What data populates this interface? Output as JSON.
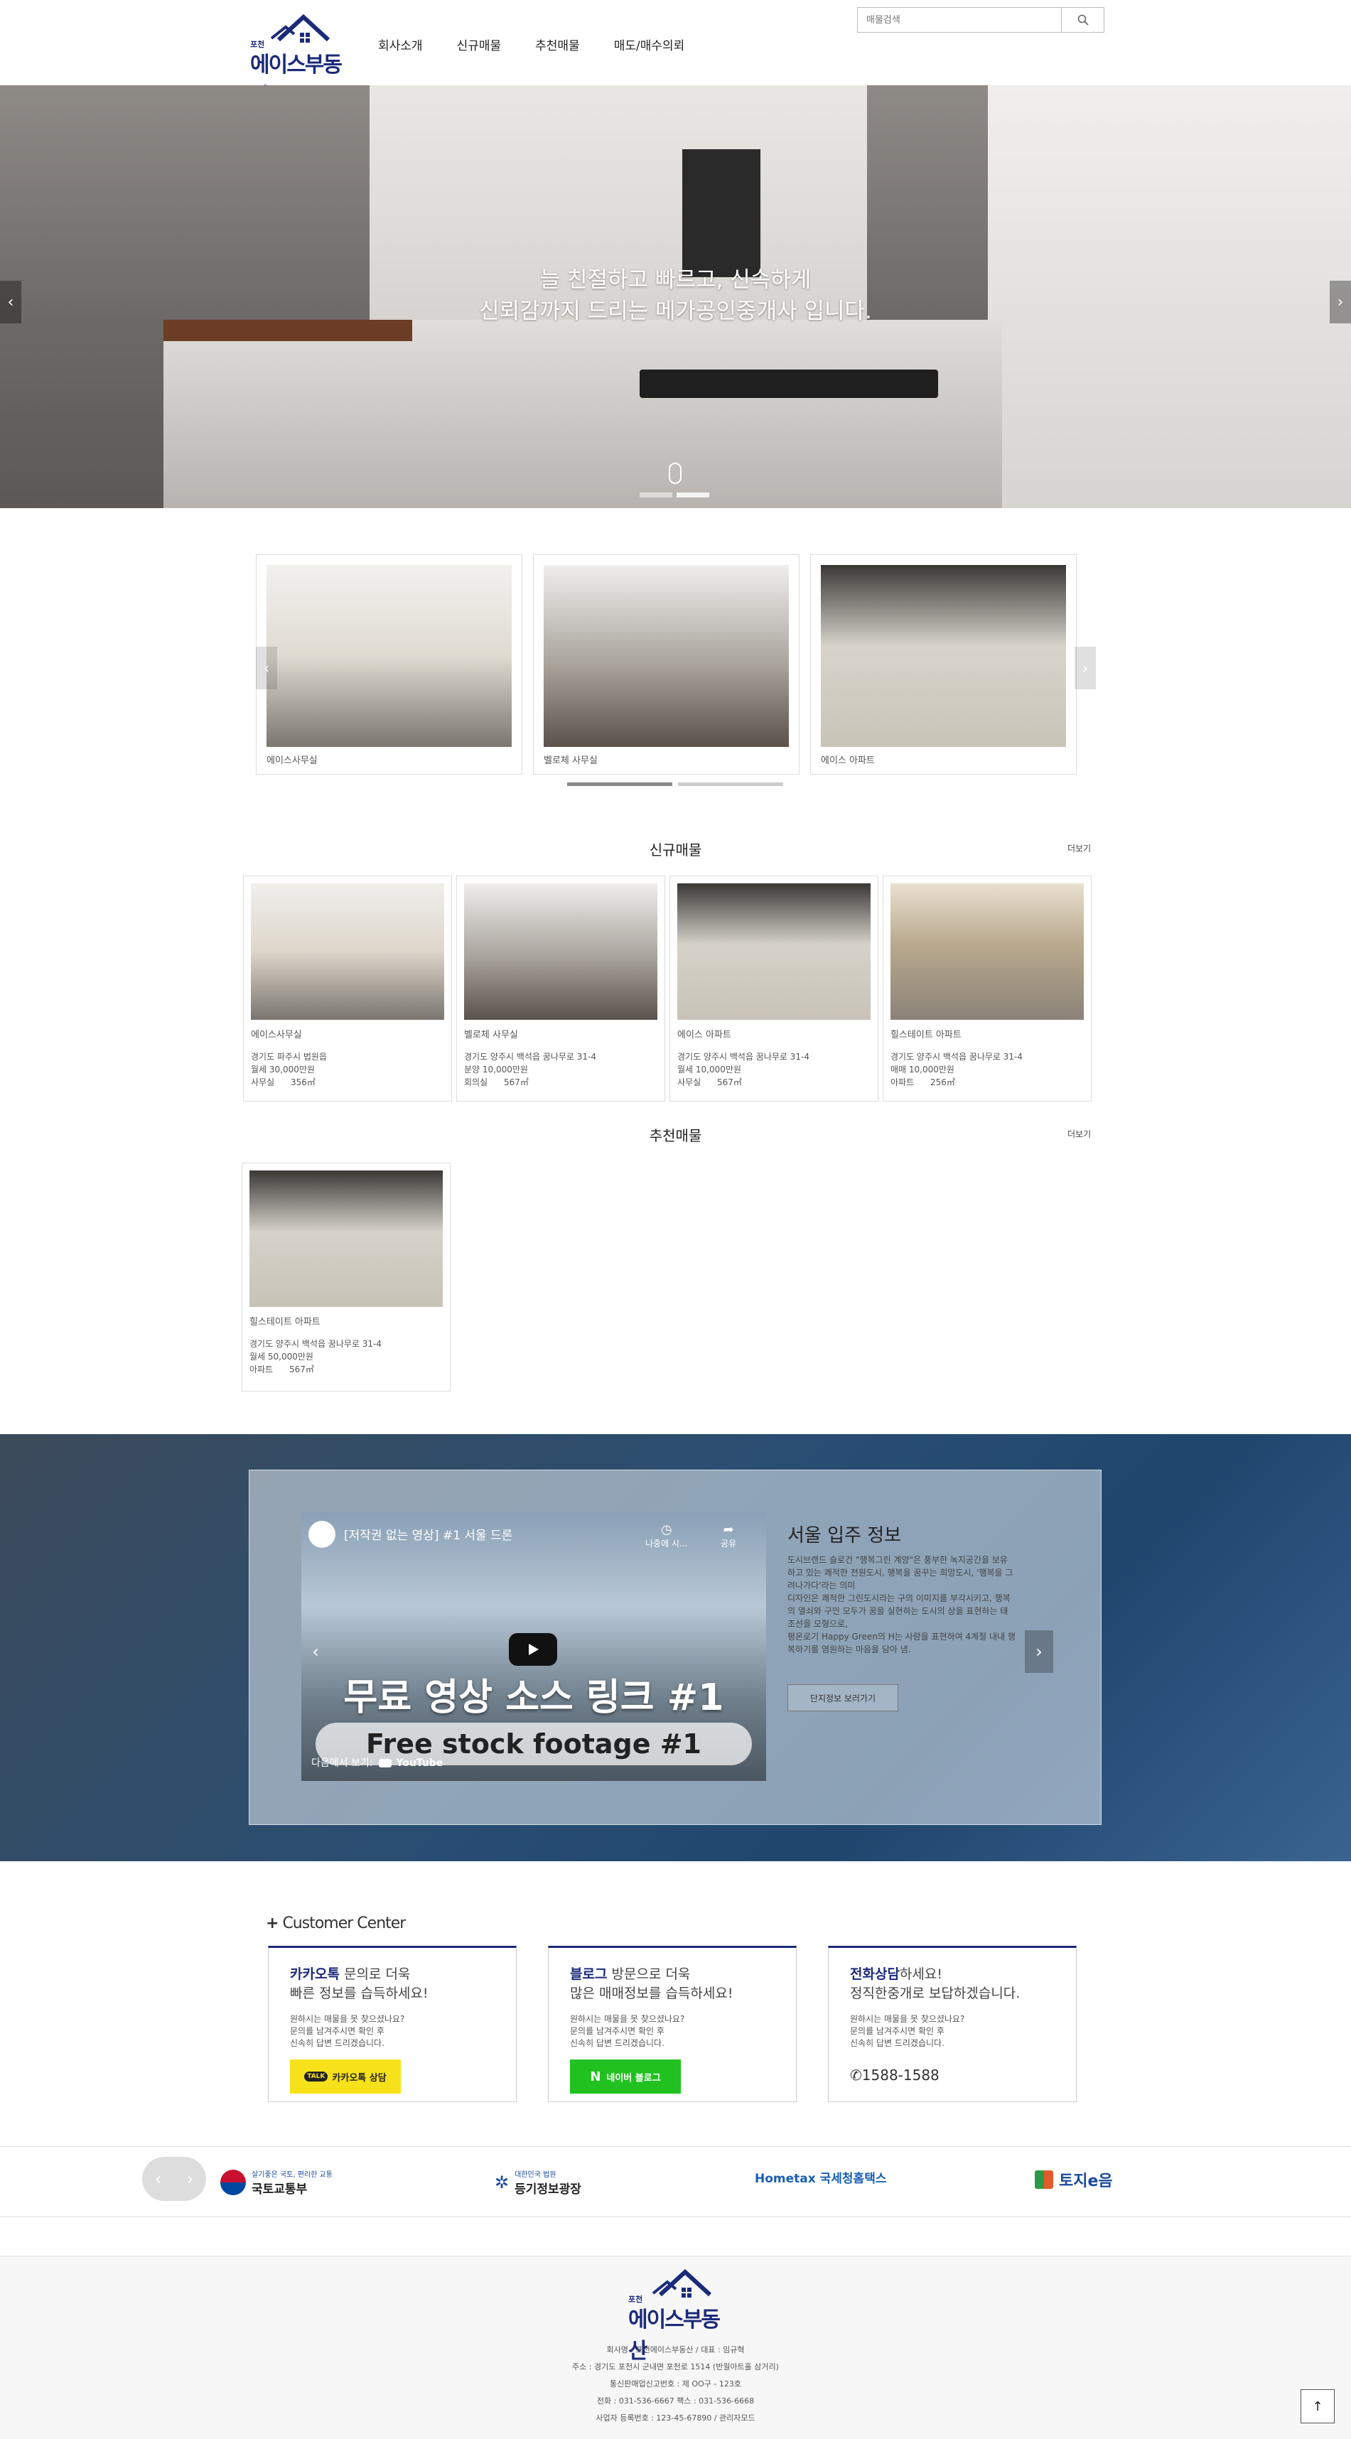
{
  "brand": {
    "small": "포천",
    "name": "에이스부동산"
  },
  "nav": [
    "회사소개",
    "신규매물",
    "추천매물",
    "매도/매수의뢰"
  ],
  "search": {
    "placeholder": "매물검색"
  },
  "hero": {
    "line1": "늘 친절하고 빠르고, 신속하게",
    "line2": "신뢰감까지 드리는 메가공인중개사 입니다."
  },
  "carousel": [
    "에이스사무실",
    "벨로체 사무실",
    "에이스 아파트"
  ],
  "new_listings": {
    "title": "신규매물",
    "more": "더보기",
    "items": [
      {
        "name": "에이스사무실",
        "addr": "경기도 파주시 법원읍",
        "price": "월세 30,000만원",
        "type": "사무실",
        "area": "356㎡"
      },
      {
        "name": "벨로체 사무실",
        "addr": "경기도 양주시 백석읍 꿈나무로 31-4",
        "price": "분양 10,000만원",
        "type": "회의실",
        "area": "567㎡"
      },
      {
        "name": "에이스 아파트",
        "addr": "경기도 양주시 백석읍 꿈나무로 31-4",
        "price": "월세 10,000만원",
        "type": "사무실",
        "area": "567㎡"
      },
      {
        "name": "힐스테이트 아파트",
        "addr": "경기도 양주시 백석읍 꿈나무로 31-4",
        "price": "매매 10,000만원",
        "type": "아파트",
        "area": "256㎡"
      }
    ]
  },
  "recommended": {
    "title": "추천매물",
    "more": "더보기",
    "items": [
      {
        "name": "힐스테이트 아파트",
        "addr": "경기도 양주시 백석읍 꿈나무로 31-4",
        "price": "월세 50,000만원",
        "type": "아파트",
        "area": "567㎡"
      }
    ]
  },
  "video": {
    "title": "[저작권 없는 영상] #1 서울 드론",
    "watch_later": "나중에 시...",
    "share": "공유",
    "big_text": "무료 영상 소스 링크 #1",
    "pill_text": "Free stock footage #1",
    "watch_on": "다음에서 보기:",
    "youtube": "YouTube"
  },
  "info": {
    "title": "서울 입주 정보",
    "desc": [
      "도시브랜드 슬로건 \"행복그린 계양\"은 풍부한 녹지공간을 보유",
      "하고 있는 쾌적한 전원도시, 행복을 꿈꾸는 희망도시, '행복을 그",
      "려나가다'라는 의미",
      "디자인은 쾌적한 그린도시라는 구의 이미지를 부각시키고, 행복",
      "의 열쇠와 구민 모두가 꿈을 실현하는 도시의 상을 표현하는 태",
      "조선을 모형으로,",
      "평온로기 Happy Green의 H는 사람을 표현하여 4계절 내내 행",
      "복하기를 염원하는 마음을 담아 냄."
    ],
    "button": "단지정보 보러가기"
  },
  "customer_center": {
    "title": "Customer Center",
    "cards": [
      {
        "strong": "카카오톡",
        "rest1": " 문의로 더욱",
        "line2": "빠른 정보를 습득하세요!",
        "desc": [
          "원하시는 매물을 못 찾으셨나요?",
          "문의를 남겨주시면 확인 후",
          "신속히 답변 드리겠습니다."
        ],
        "button": "카카오톡 상담"
      },
      {
        "strong": "블로그",
        "rest1": " 방문으로 더욱",
        "line2": "많은 매매정보를 습득하세요!",
        "desc": [
          "원하시는 매물을 못 찾으셨나요?",
          "문의를 남겨주시면 확인 후",
          "신속히 답변 드리겠습니다."
        ],
        "button": "네이버 블로그"
      },
      {
        "strong": "전화상담",
        "rest1": "하세요!",
        "line2": "정직한중개로 보답하겠습니다.",
        "desc": [
          "원하시는 매물을 못 찾으셨나요?",
          "문의를 남겨주시면 확인 후",
          "신속히 답변 드리겠습니다."
        ],
        "phone": "1588-1588"
      }
    ]
  },
  "partners": [
    {
      "sub": "살기좋은 국토, 편리한 교통",
      "name": "국토교통부"
    },
    {
      "sub": "대한민국 법원",
      "name": "등기정보광장"
    },
    {
      "sub": "",
      "name": "Hometax 국세청홈택스"
    },
    {
      "sub": "",
      "name": "토지e음"
    }
  ],
  "footer": {
    "lines": [
      "회사명 : 포천에이스부동산 / 대표 : 임규혁",
      "주소 : 경기도 포천시 군내면 포천로 1514 (반월아트홀 삼거리)",
      "통신판매업신고번호 : 제 OO구 - 123호",
      "전화 : 031-536-6667 팩스 : 031-536-6668",
      "사업자 등록번호 : 123-45-67890 / 관리자모드"
    ]
  },
  "colors": {
    "brand": "#1b2b7a",
    "kakao": "#f7e11a",
    "naver": "#21c21f"
  }
}
